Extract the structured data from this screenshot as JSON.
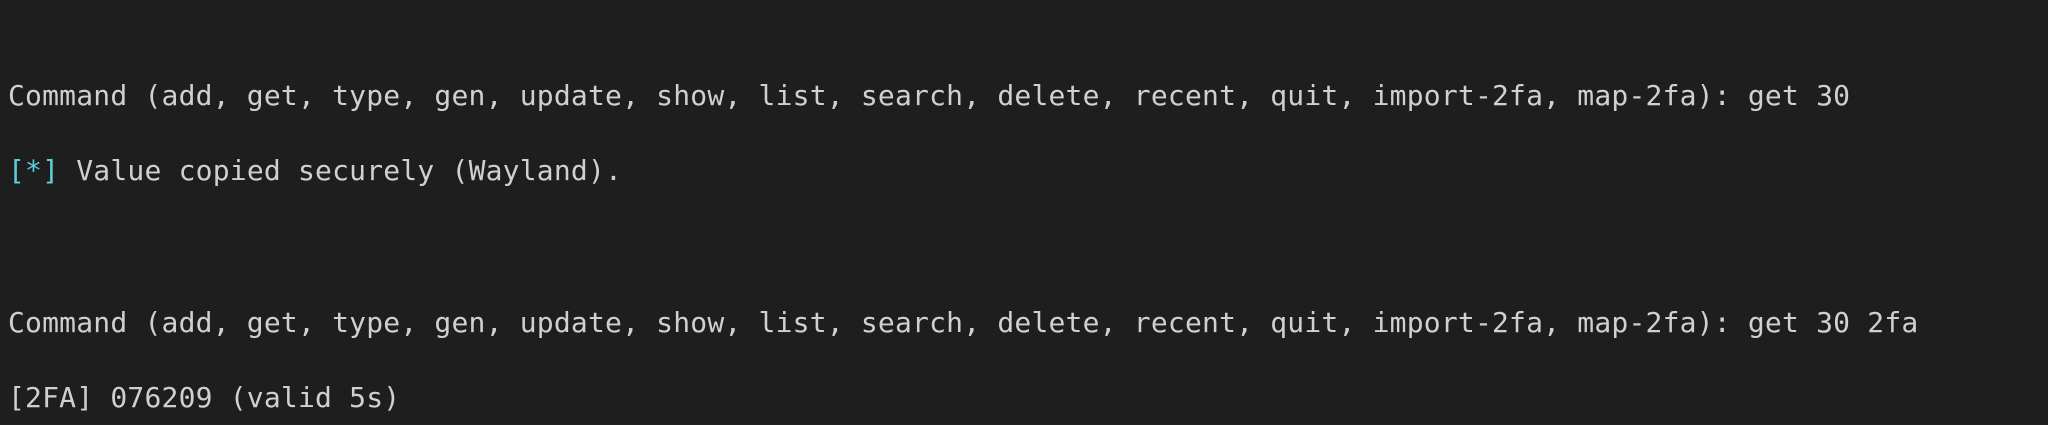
{
  "terminal": {
    "lines": [
      {
        "prompt": "Command (add, get, type, gen, update, show, list, search, delete, recent, quit, import-2fa, map-2fa): ",
        "input": "get 30"
      },
      {
        "tag": "[*]",
        "message": " Value copied securely (Wayland)."
      },
      {
        "prompt": "Command (add, get, type, gen, update, show, list, search, delete, recent, quit, import-2fa, map-2fa): ",
        "input": "get 30 2fa"
      },
      {
        "text": "[2FA] 076209 (valid 5s)"
      }
    ]
  },
  "colors": {
    "background": "#1e1e1e",
    "foreground": "#d0d0d0",
    "accent": "#5ad1d8"
  }
}
